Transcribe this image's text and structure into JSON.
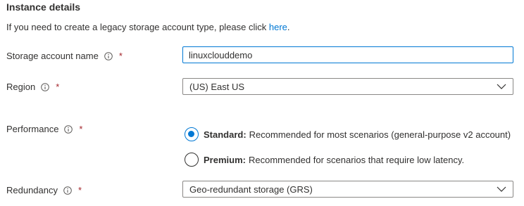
{
  "section": {
    "title": "Instance details",
    "intro_text": "If you need to create a legacy storage account type, please click ",
    "intro_link": "here",
    "intro_suffix": "."
  },
  "fields": {
    "storage_account_name": {
      "label": "Storage account name",
      "required_mark": "*",
      "value": "linuxclouddemo"
    },
    "region": {
      "label": "Region",
      "required_mark": "*",
      "value": "(US) East US"
    },
    "performance": {
      "label": "Performance",
      "required_mark": "*",
      "options": [
        {
          "title": "Standard:",
          "description": "Recommended for most scenarios (general-purpose v2 account)",
          "selected": true
        },
        {
          "title": "Premium:",
          "description": "Recommended for scenarios that require low latency.",
          "selected": false
        }
      ]
    },
    "redundancy": {
      "label": "Redundancy",
      "required_mark": "*",
      "value": "Geo-redundant storage (GRS)"
    }
  },
  "icons": {
    "info": "info-icon",
    "chevron": "chevron-down-icon"
  },
  "colors": {
    "accent": "#0078d4",
    "required": "#a4262c",
    "text": "#323130",
    "border": "#8a8886"
  }
}
